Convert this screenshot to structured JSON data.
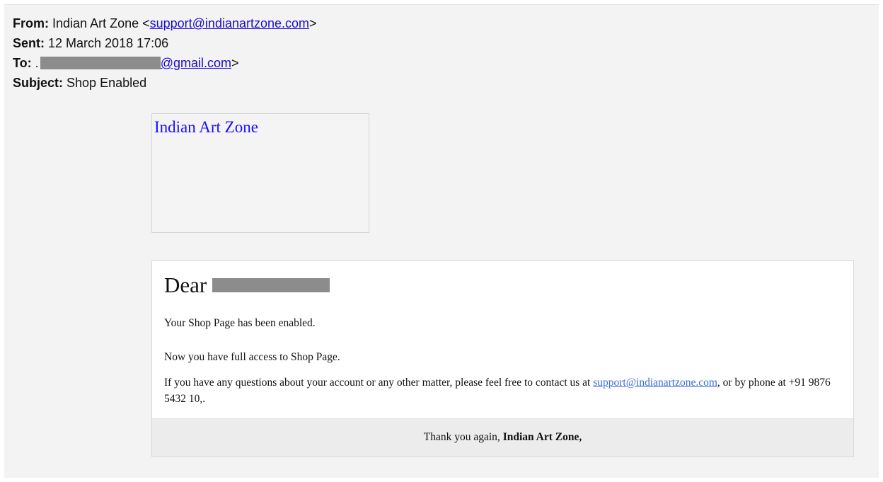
{
  "header": {
    "from_label": "From:",
    "from_name": "Indian Art Zone",
    "from_email": "support@indianartzone.com",
    "sent_label": "Sent:",
    "sent_value": "12 March 2018 17:06",
    "to_label": "To:",
    "to_prefix": ".",
    "to_domain": "@gmail.com",
    "subject_label": "Subject:",
    "subject_value": "Shop Enabled"
  },
  "logo": {
    "alt_text": "Indian Art Zone"
  },
  "body": {
    "greeting": "Dear",
    "line1": "Your Shop Page has been enabled.",
    "line2": "Now you have full access to Shop Page.",
    "line3_before": "If you have any questions about your account or any other matter, please feel free to contact us at ",
    "line3_link": "support@indianartzone.com",
    "line3_after": ", or by phone at +91 9876 5432 10,."
  },
  "footer": {
    "thanks": "Thank you again, ",
    "signature": "Indian Art Zone,"
  },
  "colors": {
    "link": "#1a0dcc",
    "body_link": "#3a6fd8",
    "redaction": "#8c8c8c"
  }
}
